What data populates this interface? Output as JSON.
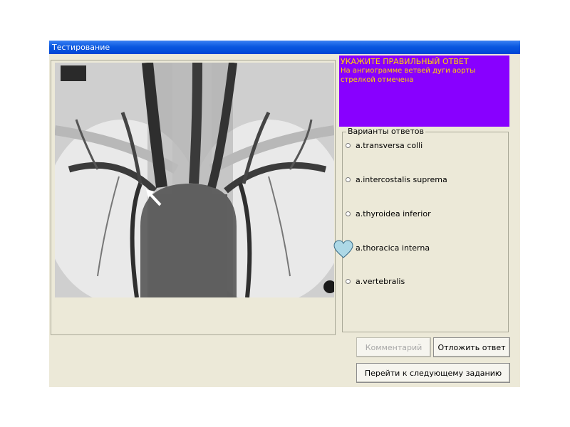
{
  "window": {
    "title": "Тестирование"
  },
  "prompt": {
    "title": "УКАЖИТЕ ПРАВИЛЬНЫЙ ОТВЕТ",
    "text": "На ангиограмме ветвей дуги аорты стрелкой отмечена"
  },
  "answers": {
    "legend": "Варианты ответов",
    "options": [
      {
        "label": "a.transversa colli",
        "selected": false
      },
      {
        "label": "a.intercostalis suprema",
        "selected": false
      },
      {
        "label": "a.thyroidea inferior",
        "selected": false
      },
      {
        "label": "a.thoracica interna",
        "selected": false
      },
      {
        "label": "a.vertebralis",
        "selected": false
      }
    ]
  },
  "buttons": {
    "comment": "Комментарий",
    "postpone": "Отложить ответ",
    "next": "Перейти к следующему заданию"
  },
  "colors": {
    "title_bar": "#0a58e0",
    "prompt_bg": "#8800ff",
    "prompt_text": "#ffd400",
    "window_bg": "#ece9d8",
    "heart": "#add8e6"
  },
  "icons": {
    "cursor": "heart-cursor-icon",
    "image_marker": "arrow-pointer-icon"
  }
}
